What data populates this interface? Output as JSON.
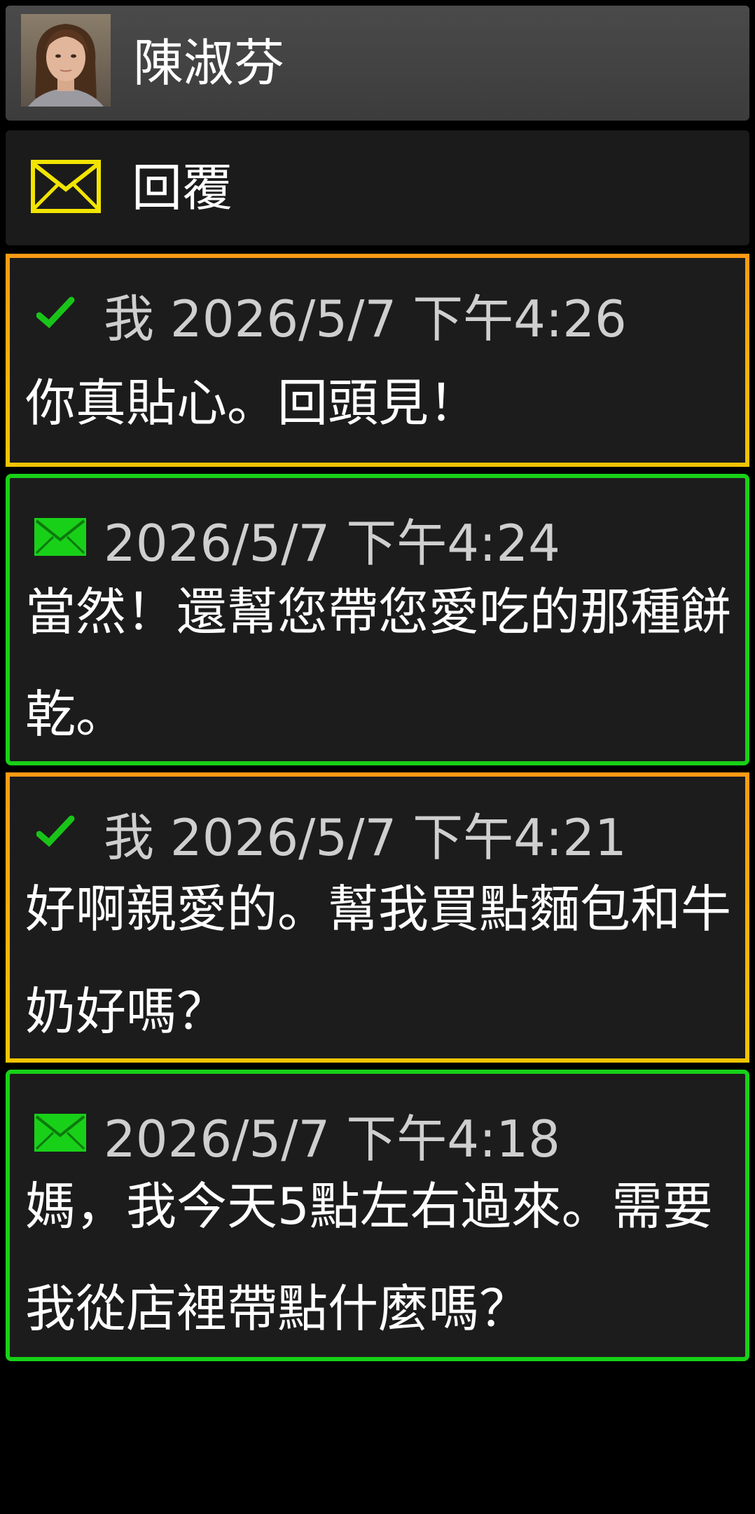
{
  "contact": {
    "name": "陳淑芬"
  },
  "reply": {
    "label": "回覆"
  },
  "messages": [
    {
      "direction": "sent",
      "meta": "我 2026/5/7 下午4:26",
      "text": "你真貼心。回頭見！",
      "status_icon": "checkmark-icon"
    },
    {
      "direction": "received",
      "meta": "2026/5/7 下午4:24",
      "text": "當然！還幫您帶您愛吃的那種餅乾。",
      "status_icon": "envelope-icon"
    },
    {
      "direction": "sent",
      "meta": "我 2026/5/7 下午4:21",
      "text": "好啊親愛的。幫我買點麵包和牛奶好嗎？",
      "status_icon": "checkmark-icon"
    },
    {
      "direction": "received",
      "meta": "2026/5/7 下午4:18",
      "text": "媽，我今天5點左右過來。需要我從店裡帶點什麼嗎？",
      "status_icon": "envelope-icon"
    }
  ],
  "colors": {
    "sent_border": "#f5a000",
    "received_border": "#18d018",
    "reply_icon": "#f2e400",
    "check": "#19c419",
    "received_envelope": "#19d019"
  }
}
